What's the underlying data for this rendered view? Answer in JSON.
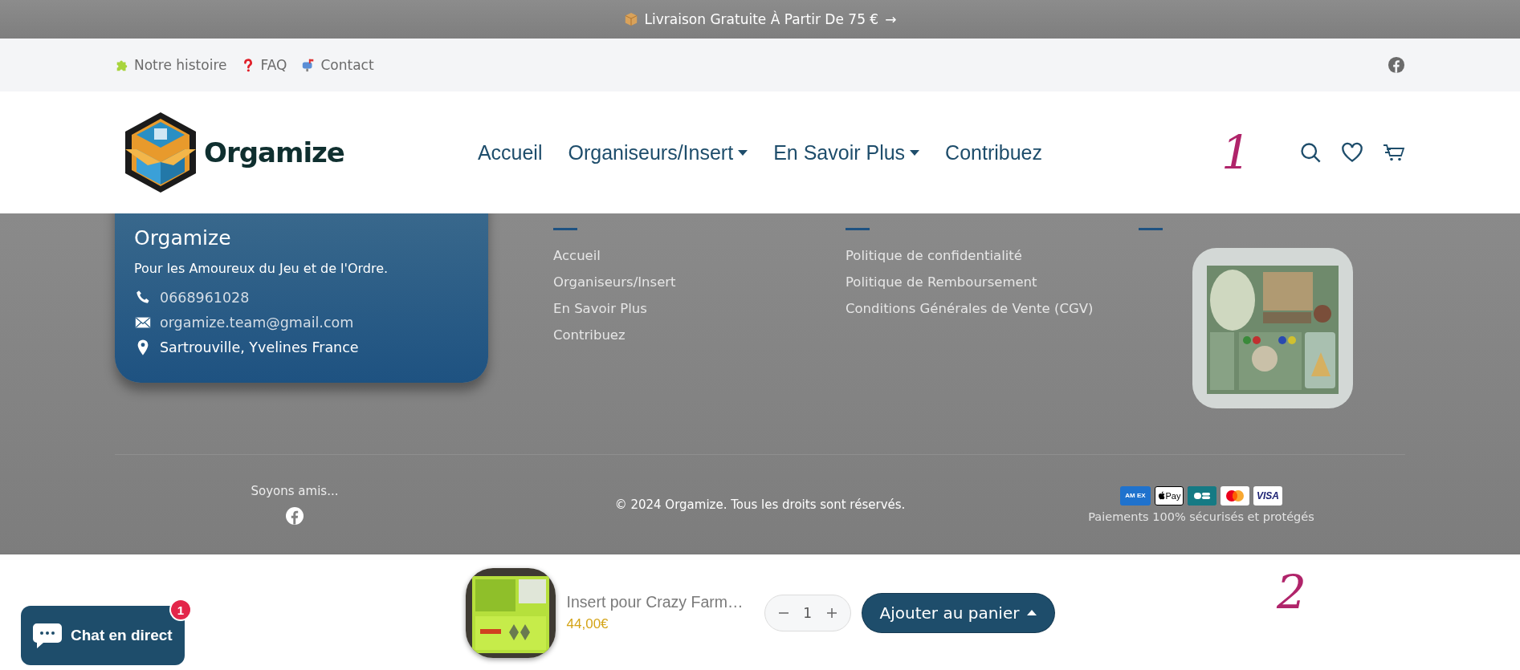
{
  "announcement": {
    "text": "Livraison Gratuite À Partir De 75 €",
    "arrow": "→"
  },
  "top_links": [
    {
      "kind": "puzzle",
      "label": "Notre histoire"
    },
    {
      "kind": "question",
      "label": "FAQ"
    },
    {
      "kind": "mailbox",
      "label": "Contact"
    }
  ],
  "header": {
    "brand": "Orgamize",
    "nav": [
      {
        "label": "Accueil",
        "has_dropdown": false
      },
      {
        "label": "Organiseurs/Insert",
        "has_dropdown": true
      },
      {
        "label": "En Savoir Plus",
        "has_dropdown": true
      },
      {
        "label": "Contribuez",
        "has_dropdown": false
      }
    ]
  },
  "annotations": [
    "1",
    "2"
  ],
  "footer": {
    "card": {
      "title": "Orgamize",
      "tagline": "Pour les Amoureux du Jeu et de l'Ordre.",
      "contacts": [
        {
          "kind": "phone",
          "text": "0668961028"
        },
        {
          "kind": "email",
          "text": "orgamize.team@gmail.com"
        },
        {
          "kind": "location",
          "text": "Sartrouville, Yvelines France"
        }
      ]
    },
    "columns": [
      {
        "links": [
          "Accueil",
          "Organiseurs/Insert",
          "En Savoir Plus",
          "Contribuez"
        ]
      },
      {
        "links": [
          "Politique de confidentialité",
          "Politique de Remboursement",
          "Conditions Générales de Vente (CGV)"
        ]
      },
      {
        "kind": "picture"
      }
    ],
    "social_label": "Soyons amis...",
    "copyright": "© 2024 Orgamize. Tous les droits sont réservés.",
    "payments": [
      {
        "kind": "amex",
        "label": "AM EX"
      },
      {
        "kind": "applepay",
        "label": "Pay"
      },
      {
        "kind": "cb"
      },
      {
        "kind": "mastercard"
      },
      {
        "kind": "visa",
        "label": "VISA"
      }
    ],
    "payments_note": "Paiements 100% sécurisés et protégés"
  },
  "sticky_bar": {
    "product": "Insert pour Crazy Farm…",
    "price": "44,00€",
    "quantity": "1",
    "button": "Ajouter au panier"
  },
  "chat": {
    "label": "Chat en direct",
    "badge": "1"
  }
}
